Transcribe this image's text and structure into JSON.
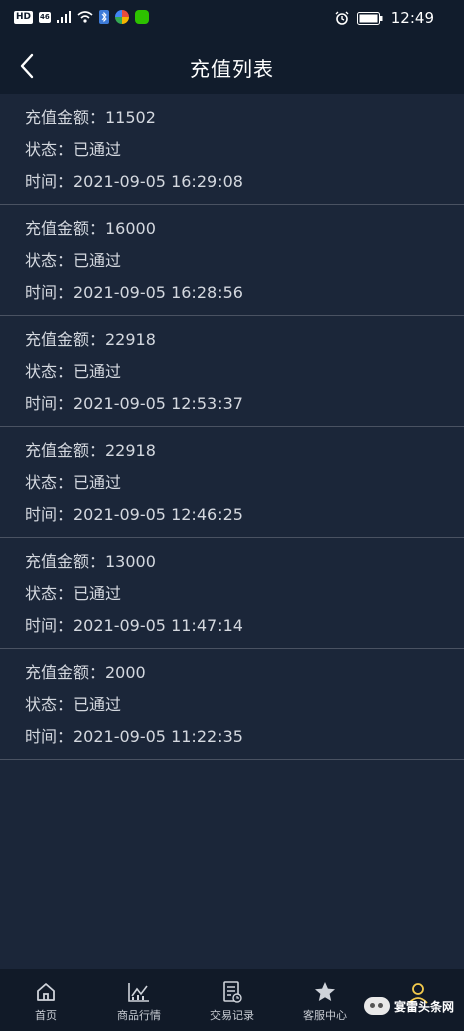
{
  "status_bar": {
    "left_tags": [
      "HD",
      "46"
    ],
    "time": "12:49",
    "icons": [
      "signal-icon",
      "wifi-icon",
      "bluetooth-icon",
      "app-icon",
      "wechat-icon",
      "alarm-icon",
      "battery-icon"
    ]
  },
  "header": {
    "title": "充值列表",
    "back_icon": "chevron-left-icon"
  },
  "records": [
    {
      "amount": "充值金额：11502",
      "status": "状态：已通过",
      "time": "时间：2021-09-05 16:29:08"
    },
    {
      "amount": "充值金额：16000",
      "status": "状态：已通过",
      "time": "时间：2021-09-05 16:28:56"
    },
    {
      "amount": "充值金额：22918",
      "status": "状态：已通过",
      "time": "时间：2021-09-05 12:53:37"
    },
    {
      "amount": "充值金额：22918",
      "status": "状态：已通过",
      "time": "时间：2021-09-05 12:46:25"
    },
    {
      "amount": "充值金额：13000",
      "status": "状态：已通过",
      "time": "时间：2021-09-05 11:47:14"
    },
    {
      "amount": "充值金额：2000",
      "status": "状态：已通过",
      "time": "时间：2021-09-05 11:22:35"
    }
  ],
  "tabs": [
    {
      "label": "首页",
      "icon": "home-icon"
    },
    {
      "label": "商品行情",
      "icon": "chart-icon"
    },
    {
      "label": "交易记录",
      "icon": "document-icon"
    },
    {
      "label": "客服中心",
      "icon": "star-icon"
    },
    {
      "label": "",
      "icon": "user-icon"
    }
  ],
  "watermark": "宴雷头条网",
  "colors": {
    "background": "#1b2639",
    "header": "#111c2c",
    "accent": "#f2c94c",
    "divider": "#4a5262"
  }
}
